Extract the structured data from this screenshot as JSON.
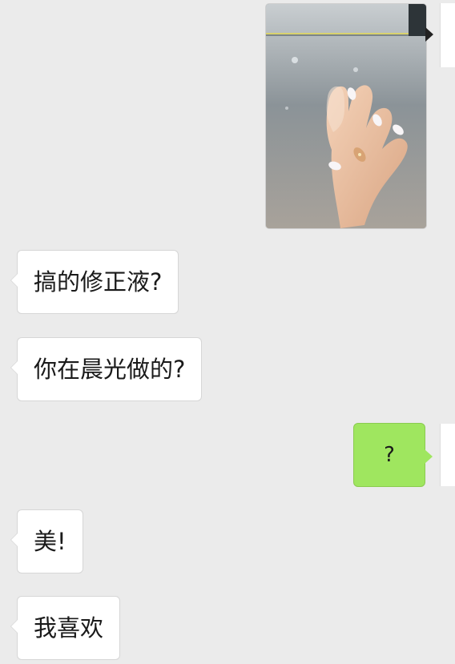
{
  "chat": {
    "incoming_messages": [
      "搞的修正液?",
      "你在晨光做的?",
      "美!",
      "我喜欢"
    ],
    "outgoing_messages": [
      "?"
    ],
    "photo": {
      "subject": "manicured-hand-photo"
    }
  },
  "colors": {
    "background": "#ebebeb",
    "incoming_bubble": "#ffffff",
    "outgoing_bubble": "#9fe65f",
    "text": "#1a1a1a"
  }
}
